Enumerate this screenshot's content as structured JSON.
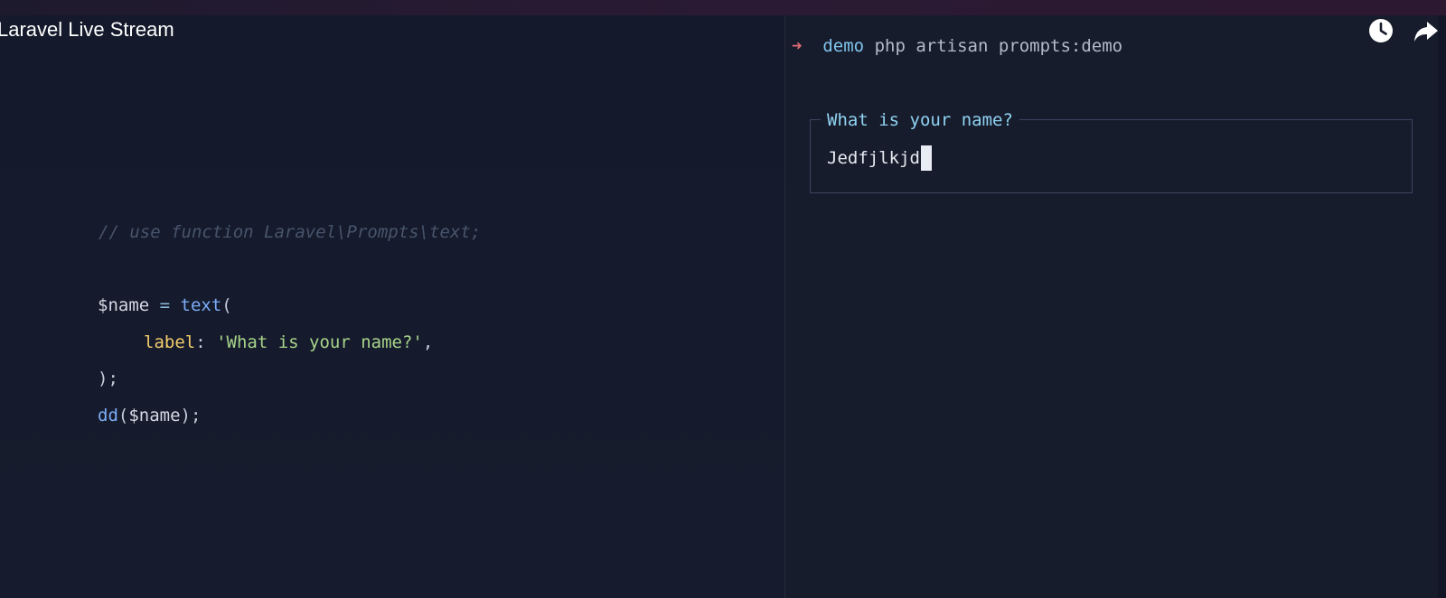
{
  "video": {
    "title": "Laravel Live Stream",
    "icons": [
      "watch-later-icon",
      "share-icon"
    ]
  },
  "code_panel": {
    "comment": "// use function Laravel\\Prompts\\text;",
    "assign": {
      "variable": "$name",
      "operator": " = ",
      "function": "text",
      "open_paren": "("
    },
    "label_line": {
      "key": "label",
      "colon": ": ",
      "value": "'What is your name?'",
      "trailing": ","
    },
    "close_line": ");",
    "dd_line": {
      "function": "dd",
      "open_paren": "(",
      "argument": "$name",
      "close": ");"
    }
  },
  "terminal": {
    "arrow": "➜",
    "directory": "demo",
    "command": "php artisan prompts:demo",
    "prompt_label": "What is your name?",
    "input_value": "Jedfjlkjd"
  },
  "colors": {
    "background": "#161b2c",
    "string": "#a8d48a",
    "key": "#f2cc6c",
    "function": "#7cacf8",
    "prompt_label": "#8fd3f2",
    "arrow": "#e06c75"
  }
}
